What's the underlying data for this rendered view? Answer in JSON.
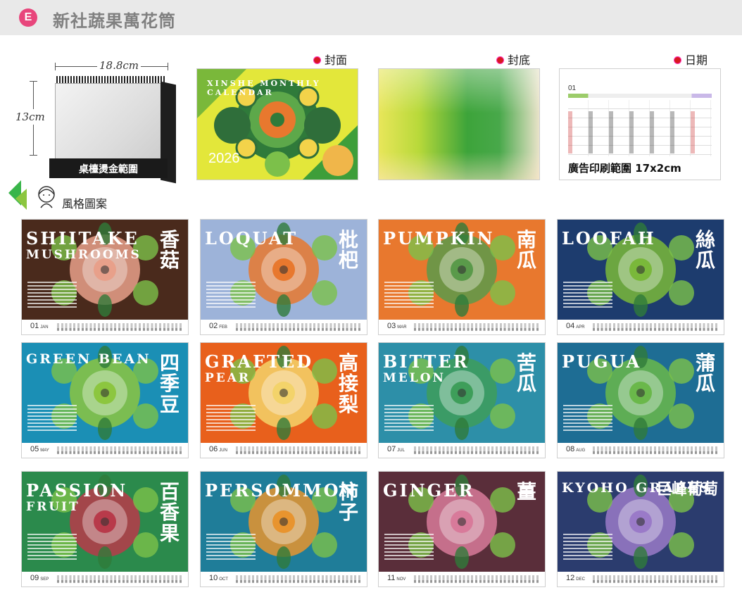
{
  "header": {
    "badge": "E",
    "title": "新社蔬果萬花筒"
  },
  "labels": {
    "cover": "封面",
    "back": "封底",
    "date": "日期",
    "style": "風格圖案"
  },
  "desk": {
    "width_label": "18.8cm",
    "height_label": "13cm",
    "imprint": "桌檯燙金範圍"
  },
  "cover": {
    "en_title": "XINSHE MONTHLY CALENDAR",
    "year": "2026"
  },
  "date_page": {
    "month": "01",
    "ad_text": "廣告印刷範圍 17x2cm"
  },
  "months": [
    {
      "num": "01",
      "mon": "JAN",
      "en": "SHIITAKE",
      "en2": "MUSHROOMS",
      "zh": "香菇",
      "bg": "#4a2a1c"
    },
    {
      "num": "02",
      "mon": "FEB",
      "en": "LOQUAT",
      "zh": "枇杷",
      "bg": "#9db3d9"
    },
    {
      "num": "03",
      "mon": "MAR",
      "en": "PUMPKIN",
      "zh": "南瓜",
      "bg": "#e8782e"
    },
    {
      "num": "04",
      "mon": "APR",
      "en": "LOOFAH",
      "zh": "絲瓜",
      "bg": "#1d3c6e"
    },
    {
      "num": "05",
      "mon": "MAY",
      "en": "GREEN BEAN",
      "zh": "四季豆",
      "bg": "#1b8fb5"
    },
    {
      "num": "06",
      "mon": "JUN",
      "en": "GRAFTED",
      "en2": "PEAR",
      "zh": "高接梨",
      "bg": "#e8601c"
    },
    {
      "num": "07",
      "mon": "JUL",
      "en": "BITTER",
      "en2": "MELON",
      "zh": "苦瓜",
      "bg": "#2d8fa8"
    },
    {
      "num": "08",
      "mon": "AUG",
      "en": "PUGUA",
      "zh": "蒲瓜",
      "bg": "#1e6d94"
    },
    {
      "num": "09",
      "mon": "SEP",
      "en": "PASSION",
      "en2": "FRUIT",
      "zh": "百香果",
      "bg": "#2b8a4c"
    },
    {
      "num": "10",
      "mon": "OCT",
      "en": "PERSOMMON",
      "zh": "柿子",
      "bg": "#1f7d99"
    },
    {
      "num": "11",
      "mon": "NOV",
      "en": "GINGER",
      "zh": "薑",
      "bg": "#5a2e3a"
    },
    {
      "num": "12",
      "mon": "DEC",
      "en": "KYOHO GRAPES",
      "zh": "巨峰葡萄",
      "bg": "#2b3c6e"
    }
  ]
}
